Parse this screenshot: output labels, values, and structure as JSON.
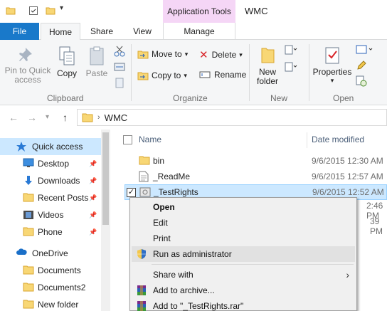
{
  "titlebar": {
    "context_tab": "Application Tools",
    "title": "WMC"
  },
  "tabs": {
    "file": "File",
    "home": "Home",
    "share": "Share",
    "view": "View",
    "manage": "Manage"
  },
  "ribbon": {
    "clipboard": {
      "pin_label": "Pin to Quick access",
      "copy_label": "Copy",
      "paste_label": "Paste",
      "group_label": "Clipboard"
    },
    "organize": {
      "move_to": "Move to",
      "copy_to": "Copy to",
      "delete": "Delete",
      "rename": "Rename",
      "group_label": "Organize"
    },
    "new": {
      "new_folder": "New folder",
      "group_label": "New"
    },
    "open": {
      "properties": "Properties",
      "group_label": "Open"
    }
  },
  "address": {
    "path": "WMC"
  },
  "navpane": {
    "items": [
      {
        "label": "Quick access",
        "icon": "star-icon",
        "selected": true,
        "pinned": false
      },
      {
        "label": "Desktop",
        "icon": "desktop-icon",
        "selected": false,
        "pinned": true
      },
      {
        "label": "Downloads",
        "icon": "download-icon",
        "selected": false,
        "pinned": true
      },
      {
        "label": "Recent Posts",
        "icon": "folder-icon",
        "selected": false,
        "pinned": true
      },
      {
        "label": "Videos",
        "icon": "video-icon",
        "selected": false,
        "pinned": true
      },
      {
        "label": "Phone",
        "icon": "folder-icon",
        "selected": false,
        "pinned": true
      },
      {
        "label": "OneDrive",
        "icon": "cloud-icon",
        "selected": false,
        "pinned": false
      },
      {
        "label": "Documents",
        "icon": "folder-icon",
        "selected": false,
        "pinned": false
      },
      {
        "label": "Documents2",
        "icon": "folder-icon",
        "selected": false,
        "pinned": false
      },
      {
        "label": "New folder",
        "icon": "folder-icon",
        "selected": false,
        "pinned": false
      }
    ]
  },
  "filelist": {
    "col_name": "Name",
    "col_date": "Date modified",
    "rows": [
      {
        "name": "bin",
        "date": "9/6/2015 12:30 AM",
        "icon": "folder-icon",
        "selected": false
      },
      {
        "name": "_ReadMe",
        "date": "9/6/2015 12:57 AM",
        "icon": "document-icon",
        "selected": false
      },
      {
        "name": "_TestRights",
        "date": "9/6/2015 12:52 AM",
        "icon": "application-icon",
        "selected": true
      }
    ],
    "partial_dates": [
      "2:46 PM",
      "39 PM"
    ]
  },
  "context_menu": {
    "items": [
      {
        "label": "Open",
        "bold": true,
        "icon": ""
      },
      {
        "label": "Edit",
        "bold": false,
        "icon": ""
      },
      {
        "label": "Print",
        "bold": false,
        "icon": ""
      },
      {
        "label": "Run as administrator",
        "bold": false,
        "icon": "shield-icon",
        "highlighted": true
      },
      {
        "label": "Share with",
        "bold": false,
        "icon": "",
        "submenu": true
      },
      {
        "label": "Add to archive...",
        "bold": false,
        "icon": "winrar-icon"
      },
      {
        "label": "Add to \"_TestRights.rar\"",
        "bold": false,
        "icon": "winrar-icon"
      }
    ]
  },
  "colors": {
    "file_tab": "#1979ca",
    "app_tools": "#f5d6f6",
    "selection": "#cce8ff",
    "folder": "#f8d775"
  }
}
